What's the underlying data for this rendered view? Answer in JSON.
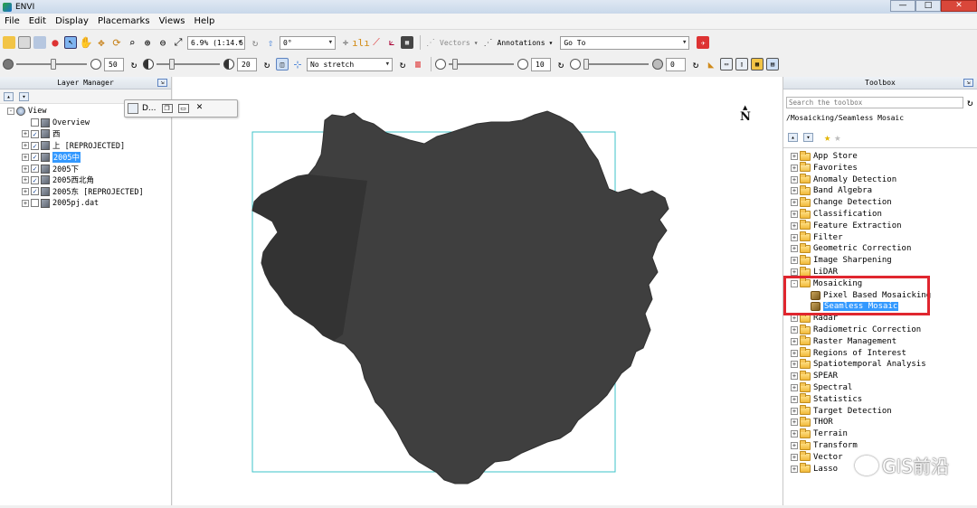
{
  "window": {
    "title": "ENVI",
    "minimize": "—",
    "maximize": "□",
    "close": "✕"
  },
  "menu": [
    {
      "label": "File"
    },
    {
      "label": "Edit"
    },
    {
      "label": "Display"
    },
    {
      "label": "Placemarks"
    },
    {
      "label": "Views"
    },
    {
      "label": "Help"
    }
  ],
  "toolbar1": {
    "zoom_value": "6.9% (1:14.6",
    "rotation_value": "0°",
    "vectors_label": "Vectors",
    "annotations_label": "Annotations",
    "goto_value": "Go To"
  },
  "toolbar2": {
    "brightness_value": "50",
    "contrast_value": "20",
    "stretch_value": "No stretch",
    "sharpen_value": "10",
    "transparency_value": "0"
  },
  "layer_manager": {
    "title": "Layer Manager",
    "items": [
      {
        "label": "View",
        "level": 0,
        "expander": "-",
        "checked": null
      },
      {
        "label": "Overview",
        "level": 1,
        "expander": "",
        "checked": false
      },
      {
        "label": "西",
        "level": 1,
        "expander": "+",
        "checked": true
      },
      {
        "label": "上 [REPROJECTED]",
        "level": 1,
        "expander": "+",
        "checked": true
      },
      {
        "label": "2005中",
        "level": 1,
        "expander": "+",
        "checked": true,
        "selected": true
      },
      {
        "label": "2005下",
        "level": 1,
        "expander": "+",
        "checked": true
      },
      {
        "label": "2005西北角",
        "level": 1,
        "expander": "+",
        "checked": true
      },
      {
        "label": "2005东 [REPROJECTED]",
        "level": 1,
        "expander": "+",
        "checked": true
      },
      {
        "label": "2005pj.dat",
        "level": 1,
        "expander": "+",
        "checked": false
      }
    ]
  },
  "float_tab": {
    "label": "D..."
  },
  "view": {
    "north_label": "N"
  },
  "toolbox": {
    "title": "Toolbox",
    "search_placeholder": "Search the toolbox",
    "path": "/Mosaicking/Seamless Mosaic",
    "items": [
      {
        "label": "App Store",
        "type": "folder",
        "level": 0
      },
      {
        "label": "Favorites",
        "type": "favorites",
        "level": 0
      },
      {
        "label": "Anomaly Detection",
        "type": "folder",
        "level": 0
      },
      {
        "label": "Band Algebra",
        "type": "folder",
        "level": 0
      },
      {
        "label": "Change Detection",
        "type": "folder",
        "level": 0
      },
      {
        "label": "Classification",
        "type": "folder",
        "level": 0
      },
      {
        "label": "Feature Extraction",
        "type": "folder",
        "level": 0
      },
      {
        "label": "Filter",
        "type": "folder",
        "level": 0
      },
      {
        "label": "Geometric Correction",
        "type": "folder",
        "level": 0
      },
      {
        "label": "Image Sharpening",
        "type": "folder",
        "level": 0
      },
      {
        "label": "LiDAR",
        "type": "folder",
        "level": 0
      },
      {
        "label": "Mosaicking",
        "type": "folder",
        "level": 0,
        "expander": "-"
      },
      {
        "label": "Pixel Based Mosaicking",
        "type": "tool",
        "level": 1
      },
      {
        "label": "Seamless Mosaic",
        "type": "tool",
        "level": 1,
        "selected": true
      },
      {
        "label": "Radar",
        "type": "folder",
        "level": 0
      },
      {
        "label": "Radiometric Correction",
        "type": "folder",
        "level": 0
      },
      {
        "label": "Raster Management",
        "type": "folder",
        "level": 0
      },
      {
        "label": "Regions of Interest",
        "type": "folder",
        "level": 0
      },
      {
        "label": "Spatiotemporal Analysis",
        "type": "folder",
        "level": 0
      },
      {
        "label": "SPEAR",
        "type": "folder",
        "level": 0
      },
      {
        "label": "Spectral",
        "type": "folder",
        "level": 0
      },
      {
        "label": "Statistics",
        "type": "folder",
        "level": 0
      },
      {
        "label": "Target Detection",
        "type": "folder",
        "level": 0
      },
      {
        "label": "THOR",
        "type": "folder",
        "level": 0
      },
      {
        "label": "Terrain",
        "type": "folder",
        "level": 0
      },
      {
        "label": "Transform",
        "type": "folder",
        "level": 0
      },
      {
        "label": "Vector",
        "type": "folder",
        "level": 0
      },
      {
        "label": "Lasso",
        "type": "folder",
        "level": 0
      }
    ]
  },
  "watermark": {
    "text": "GIS前沿"
  },
  "colors": {
    "selection": "#3399ff",
    "highlight_box": "#e0262f",
    "image_extent": "#3ec3c9",
    "raster": "#3f3f3f"
  }
}
